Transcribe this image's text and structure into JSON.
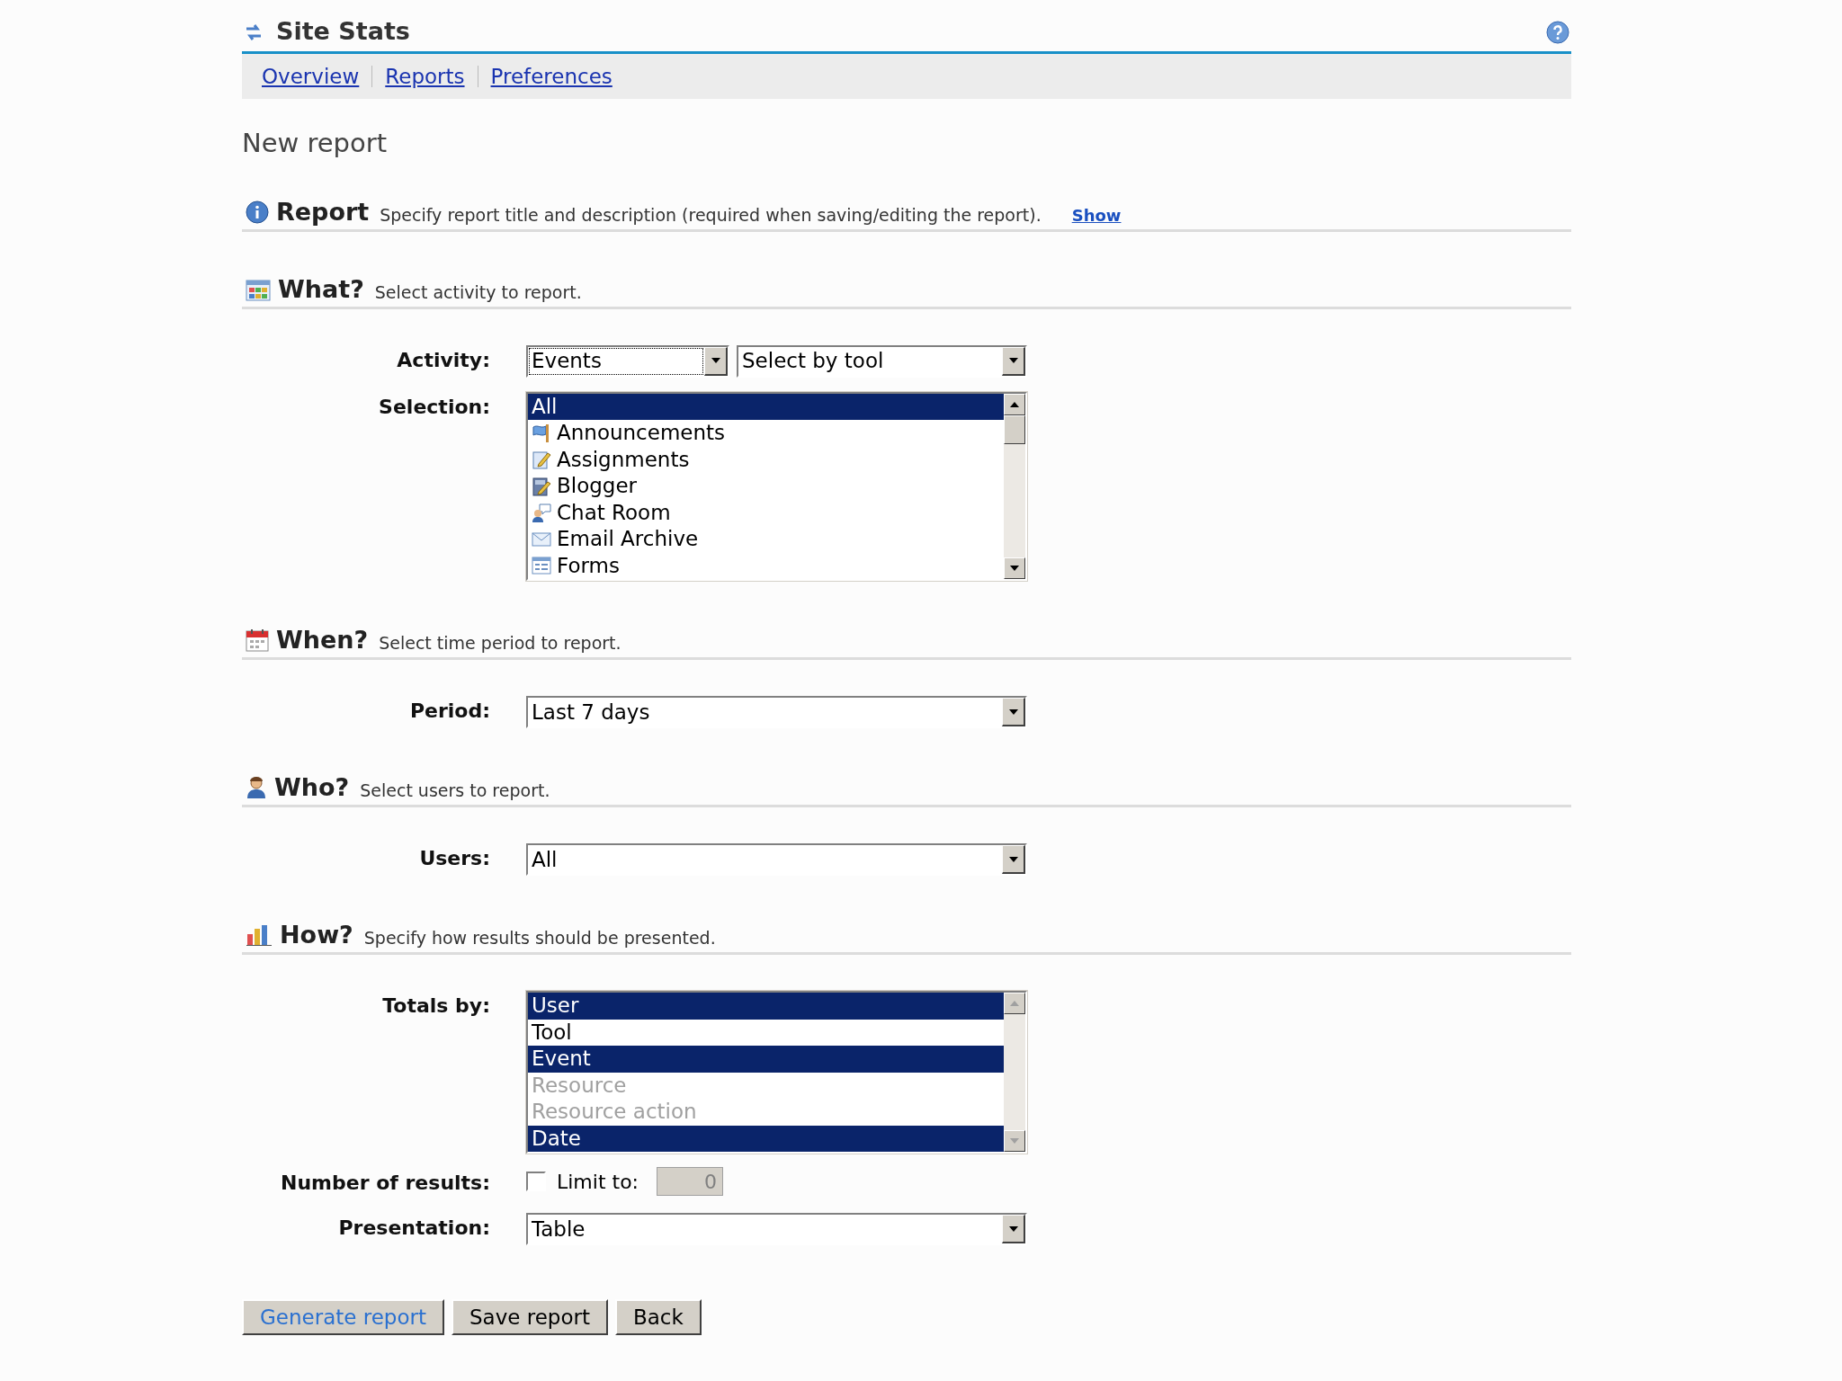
{
  "header": {
    "title": "Site Stats"
  },
  "nav": [
    {
      "label": "Overview"
    },
    {
      "label": "Reports"
    },
    {
      "label": "Preferences"
    }
  ],
  "page_title": "New report",
  "sections": [
    {
      "kind": "report",
      "title": "Report",
      "description": "Specify report title and description (required when saving/editing the report).",
      "link": "Show"
    },
    {
      "kind": "what",
      "title": "What?",
      "description": "Select activity to report.",
      "fields": [
        {
          "kind": "selects",
          "label": "Activity:",
          "selects": [
            {
              "value": "Events",
              "focused": true
            },
            {
              "value": "Select by tool",
              "focused": false
            }
          ]
        },
        {
          "kind": "listbox",
          "label": "Selection:",
          "items": [
            {
              "label": "All",
              "selected": true,
              "disabled": false
            },
            {
              "label": "Announcements",
              "selected": false,
              "disabled": false
            },
            {
              "label": "Assignments",
              "selected": false,
              "disabled": false
            },
            {
              "label": "Blogger",
              "selected": false,
              "disabled": false
            },
            {
              "label": "Chat Room",
              "selected": false,
              "disabled": false
            },
            {
              "label": "Email Archive",
              "selected": false,
              "disabled": false
            },
            {
              "label": "Forms",
              "selected": false,
              "disabled": false
            }
          ]
        }
      ]
    },
    {
      "kind": "when",
      "title": "When?",
      "description": "Select time period to report.",
      "fields": [
        {
          "kind": "selects",
          "label": "Period:",
          "selects": [
            {
              "value": "Last 7 days",
              "focused": false
            }
          ]
        }
      ]
    },
    {
      "kind": "who",
      "title": "Who?",
      "description": "Select users to report.",
      "fields": [
        {
          "kind": "selects",
          "label": "Users:",
          "selects": [
            {
              "value": "All",
              "focused": false
            }
          ]
        }
      ]
    },
    {
      "kind": "how",
      "title": "How?",
      "description": "Specify how results should be presented.",
      "fields": [
        {
          "kind": "listbox",
          "label": "Totals by:",
          "items": [
            {
              "label": "User",
              "selected": true,
              "disabled": false
            },
            {
              "label": "Tool",
              "selected": false,
              "disabled": false
            },
            {
              "label": "Event",
              "selected": true,
              "disabled": false
            },
            {
              "label": "Resource",
              "selected": false,
              "disabled": true
            },
            {
              "label": "Resource action",
              "selected": false,
              "disabled": true
            },
            {
              "label": "Date",
              "selected": true,
              "disabled": false
            }
          ]
        },
        {
          "kind": "limit",
          "label": "Number of results:",
          "checked": false,
          "text": "Limit to:",
          "value": "0",
          "disabled": true
        },
        {
          "kind": "selects",
          "label": "Presentation:",
          "selects": [
            {
              "value": "Table",
              "focused": false
            }
          ]
        }
      ]
    }
  ],
  "buttons": [
    {
      "label": "Generate report",
      "kind": "primary"
    },
    {
      "label": "Save report",
      "kind": "normal"
    },
    {
      "label": "Back",
      "kind": "normal"
    }
  ]
}
